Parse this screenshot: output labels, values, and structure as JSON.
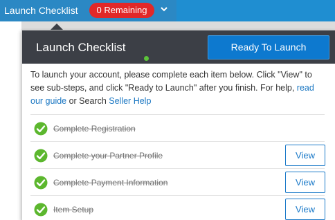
{
  "topbar": {
    "title": "Launch Checklist",
    "badge": "0 Remaining",
    "badge_color": "#e22828",
    "bar_color": "#1f8ed1",
    "dropdown_icon": "chevron-down-icon"
  },
  "panel": {
    "title": "Launch Checklist",
    "ready_button": "Ready To Launch",
    "header_color": "#3c3f46",
    "accent_color": "#0d79cf",
    "intro": {
      "text_before": "To launch your account, please complete each item below. Click \"View\" to see sub-steps, and click \"Ready to Launch\" after you finish. For help, ",
      "link1": "read our guide",
      "text_middle": " or Search ",
      "link2": "Seller Help"
    },
    "items": [
      {
        "label": "Complete Registration",
        "done": true,
        "icon": "check-circle-icon"
      },
      {
        "label": "Complete your Partner Profile",
        "done": true,
        "icon": "check-circle-icon",
        "button": "View"
      },
      {
        "label": "Complete Payment Information",
        "done": true,
        "icon": "check-circle-icon",
        "button": "View"
      },
      {
        "label": "Item Setup",
        "done": true,
        "icon": "check-circle-icon",
        "button": "View"
      }
    ]
  }
}
